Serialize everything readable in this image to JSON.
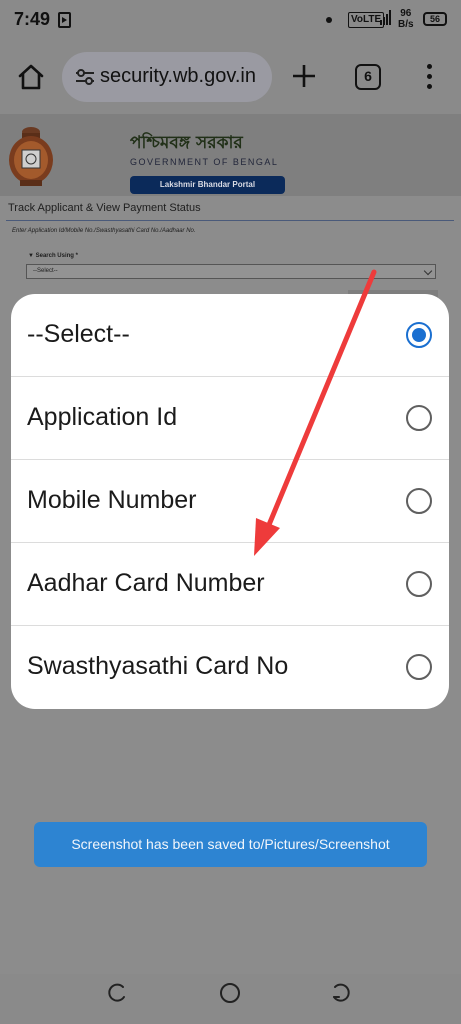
{
  "status_bar": {
    "time": "7:49",
    "volte": "VoLTE",
    "network_speed_value": "96",
    "network_speed_unit": "B/s",
    "battery": "56",
    "icons": [
      "screen-record-icon",
      "notification-dot-icon",
      "signal-icon",
      "battery-icon"
    ]
  },
  "browser": {
    "url": "security.wb.gov.in",
    "tab_count": "6",
    "icons": [
      "home-icon",
      "site-settings-icon",
      "new-tab-icon",
      "more-options-icon"
    ]
  },
  "page": {
    "title_bengali": "পশ্চিমবঙ্গ সরকার",
    "title_english": "GOVERNMENT OF BENGAL",
    "portal_name": "Lakshmir Bhandar Portal",
    "heading": "Track Applicant & View Payment Status",
    "instruction": "Enter Application Id/Mobile No./Swasthyasathi Card No./Aadhaar No.",
    "search_label": "Search Using *",
    "search_value": "--Select--"
  },
  "dialog": {
    "options": [
      {
        "label": "--Select--",
        "selected": true
      },
      {
        "label": "Application Id",
        "selected": false
      },
      {
        "label": "Mobile Number",
        "selected": false
      },
      {
        "label": "Aadhar Card Number",
        "selected": false
      },
      {
        "label": "Swasthyasathi Card No",
        "selected": false
      }
    ],
    "accent_color": "#1a6fd0"
  },
  "toast": {
    "message": "Screenshot has been saved to/Pictures/Screenshot"
  },
  "annotation": {
    "arrow_color": "#ee3b3b"
  },
  "nav_bar": {
    "icons": [
      "recents-icon",
      "home-circle-icon",
      "back-icon"
    ]
  }
}
